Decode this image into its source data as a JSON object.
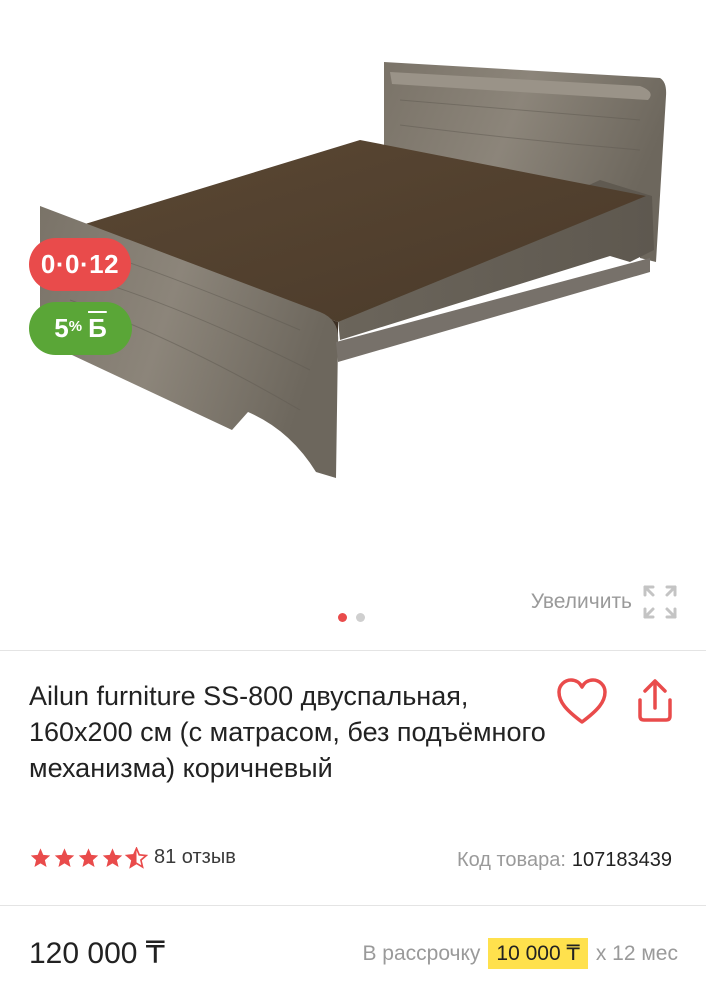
{
  "gallery": {
    "image_alt": "bed-photo",
    "installment_badge": "0·0·12",
    "bonus_badge": {
      "percent": "5",
      "unit": "%",
      "currency": "Б"
    },
    "zoom_label": "Увеличить",
    "slides_count": 2,
    "active_slide": 1
  },
  "product": {
    "title": "Ailun furniture SS-800 двуспальная, 160х200 см (с матрасом, без подъёмного механизма) коричневый",
    "rating": 4.5,
    "reviews": "81 отзыв",
    "sku_label": "Код товара:",
    "sku_value": "107183439"
  },
  "pricing": {
    "price": "120 000 ₸",
    "installment_prefix": "В рассрочку",
    "installment_amount": "10 000 ₸",
    "installment_suffix": "х 12 мес"
  },
  "colors": {
    "accent_red": "#e94b4b",
    "bonus_green": "#5aa637",
    "highlight_yellow": "#ffe14d"
  },
  "icons": [
    "expand-icon",
    "heart-icon",
    "share-icon",
    "star-icon"
  ]
}
